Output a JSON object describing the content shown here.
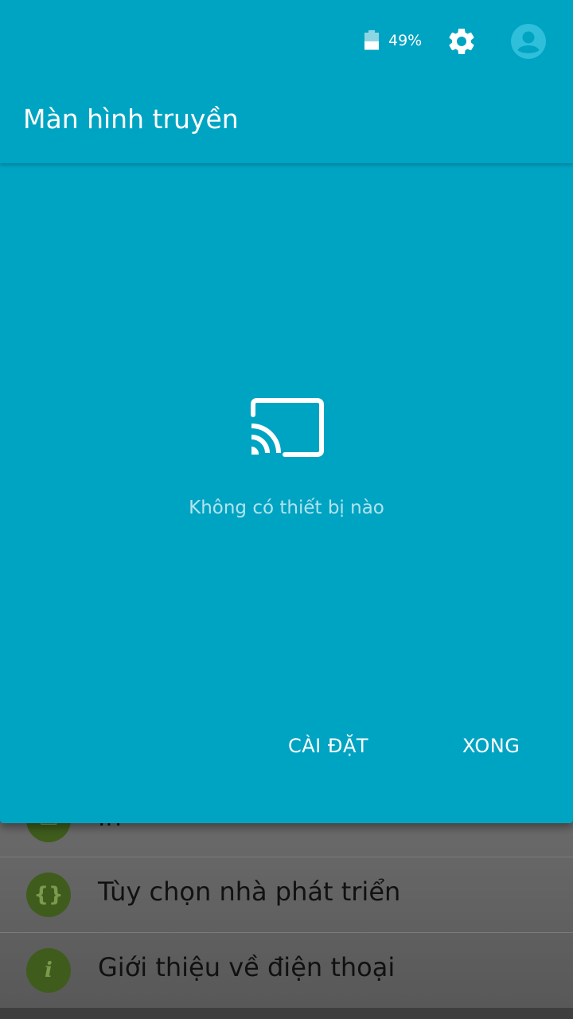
{
  "status_bar": {
    "battery_percent_label": "49%",
    "battery_level": 0.49,
    "settings_icon": "gear-icon",
    "account_icon": "account-circle-icon"
  },
  "header": {
    "title": "Màn hình truyền"
  },
  "dialog": {
    "icon": "cast-icon",
    "empty_message": "Không có thiết bị nào",
    "settings_button": "CÀI ĐẶT",
    "done_button": "XONG"
  },
  "background_list": {
    "items": [
      {
        "label": "In",
        "icon": "print-icon"
      },
      {
        "label": "Tùy chọn nhà phát triển",
        "icon": "braces-icon"
      },
      {
        "label": "Giới thiệu về điện thoại",
        "icon": "info-icon"
      }
    ]
  },
  "colors": {
    "accent": "#00a4c3",
    "icon_circle": "#3f5c1d"
  }
}
